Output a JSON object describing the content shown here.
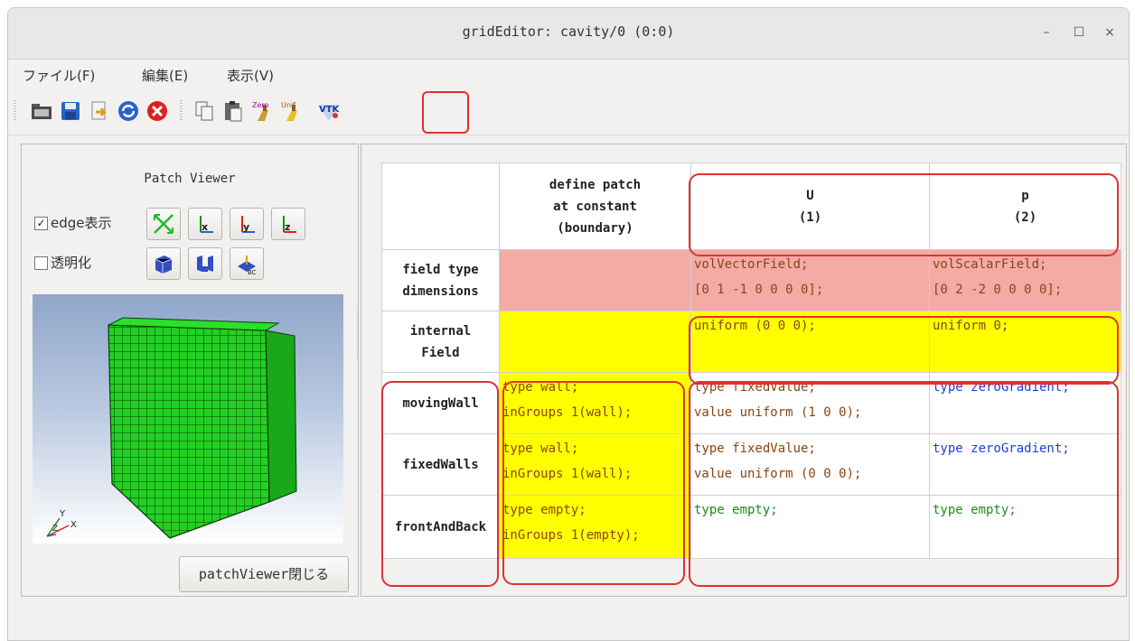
{
  "window": {
    "title": "gridEditor: cavity/0 (0:0)",
    "controls": {
      "minimize": "–",
      "maximize": "☐",
      "close": "×"
    }
  },
  "menubar": {
    "items": [
      "ファイル(F)",
      "編集(E)",
      "表示(V)"
    ]
  },
  "toolbar": {
    "icons": [
      "open-folder-icon",
      "save-icon",
      "export-icon",
      "reload-icon",
      "cancel-icon",
      "copy-icon",
      "paste-icon",
      "zero-clear-icon",
      "unif-clear-icon",
      "vtk-icon"
    ],
    "zero_label": "Zero",
    "unif_label": "Unif",
    "vtk_label": "VTK"
  },
  "patch_viewer": {
    "title": "Patch Viewer",
    "edge_label": "edge表示",
    "edge_checked": "✓",
    "transparent_label": "透明化",
    "bc_label": "BC",
    "close_label": "patchViewer閉じる",
    "axis_y": "Y",
    "axis_x": "X",
    "axis_z": "Z"
  },
  "table": {
    "header": {
      "define": [
        "define patch",
        "at constant",
        "(boundary)"
      ],
      "u": [
        "U",
        "(1)"
      ],
      "p": [
        "p",
        "(2)"
      ]
    },
    "rows": {
      "fieldtype": {
        "label": [
          "field type",
          "dimensions"
        ],
        "u": "volVectorField;\n[0 1 -1 0 0 0 0];",
        "p": "volScalarField;\n[0 2 -2 0 0 0 0];"
      },
      "internal": {
        "label": [
          "internal",
          "Field"
        ],
        "u": "uniform (0 0 0);",
        "p": "uniform 0;"
      },
      "movingwall": {
        "label": "movingWall",
        "define": "type wall;\ninGroups 1(wall);",
        "u": "type fixedValue;\nvalue uniform (1 0 0);",
        "p": "type zeroGradient;"
      },
      "fixedwalls": {
        "label": "fixedWalls",
        "define": "type wall;\ninGroups 1(wall);",
        "u": "type fixedValue;\nvalue uniform (0 0 0);",
        "p": "type zeroGradient;"
      },
      "frontandback": {
        "label": "frontAndBack",
        "define": "type empty;\ninGroups 1(empty);",
        "u": "type empty;",
        "p": "type empty;"
      }
    }
  },
  "colors": {
    "highlight": "#e03030",
    "pink": "#f4aaa5",
    "yellow": "#ffff00",
    "mesh_green": "#1fcf1f"
  }
}
